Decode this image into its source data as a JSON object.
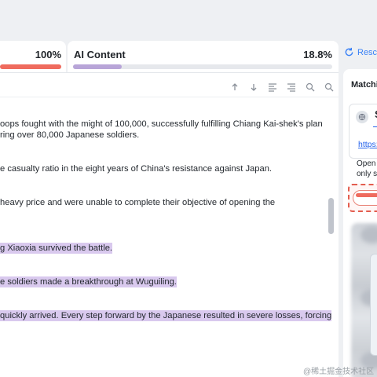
{
  "tabs": {
    "plagiarism": {
      "percent": "100%",
      "fill": 1.0
    },
    "ai": {
      "label": "AI Content",
      "percent": "18.8%",
      "fill": 0.188
    }
  },
  "toolbar_icons": [
    "arrow-up-icon",
    "arrow-down-icon",
    "align-left-icon",
    "align-right-icon",
    "zoom-in-icon",
    "zoom-out-icon"
  ],
  "document": {
    "paragraphs": [
      {
        "lines": [
          "oops fought with the might of 100,000, successfully fulfilling Chiang Kai-shek's plan",
          "ring over 80,000 Japanese soldiers."
        ],
        "highlighted": false
      },
      {
        "lines": [
          "e casualty ratio in the eight years of China's resistance against Japan."
        ],
        "highlighted": false
      },
      {
        "lines": [
          "heavy price and were unable to complete their objective of opening the"
        ],
        "highlighted": false
      },
      {
        "lines": [
          "g Xiaoxia survived the battle."
        ],
        "highlighted": true
      },
      {
        "lines": [
          "e soldiers made a breakthrough at Wuguiling."
        ],
        "highlighted": true
      },
      {
        "lines": [
          "quickly arrived. Every step forward by the Japanese resulted in severe losses, forcing"
        ],
        "highlighted": true
      }
    ]
  },
  "right_panel": {
    "rescan_label": "Resc",
    "title": "Matchi",
    "card_initial": "S",
    "card_link": "https:",
    "open_text": [
      "Open",
      "only s"
    ]
  },
  "watermark": "@稀土掘金技术社区",
  "colors": {
    "plagiarism_bar": "#ef6b5e",
    "ai_bar": "#b8a5d8",
    "highlight": "#d9c9ee",
    "link": "#2563eb"
  }
}
